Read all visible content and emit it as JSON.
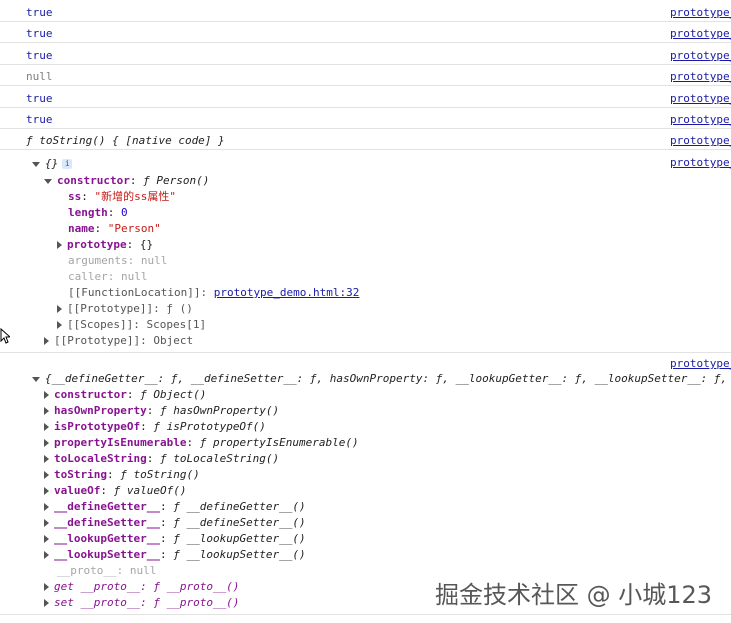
{
  "rows": [
    {
      "value": "true",
      "type": "bool",
      "link": "prototype_"
    },
    {
      "value": "true",
      "type": "bool",
      "link": "prototype_"
    },
    {
      "value": "true",
      "type": "bool",
      "link": "prototype_"
    },
    {
      "value": "null",
      "type": "null",
      "link": "prototype_"
    },
    {
      "value": "true",
      "type": "bool",
      "link": "prototype_"
    },
    {
      "value": "true",
      "type": "bool",
      "link": "prototype_"
    },
    {
      "value": "ƒ toString() { [native code] }",
      "type": "fn",
      "link": "prototype_"
    }
  ],
  "obj1": {
    "link": "prototype_",
    "summary": "{}",
    "constructor_key": "constructor",
    "constructor_val": "ƒ Person()",
    "ss_key": "ss",
    "ss_val": "\"新增的ss属性\"",
    "length_key": "length",
    "length_val": "0",
    "name_key": "name",
    "name_val": "\"Person\"",
    "prototype_key": "prototype",
    "prototype_val": "{}",
    "arguments": "arguments: null",
    "caller": "caller: null",
    "fnloc_key": "[[FunctionLocation]]: ",
    "fnloc_link": "prototype_demo.html:32",
    "proto_inner": "[[Prototype]]: ƒ ()",
    "scopes": "[[Scopes]]: Scopes[1]",
    "proto_outer": "[[Prototype]]: Object"
  },
  "obj2": {
    "link": "prototype_",
    "summary": "{__defineGetter__: ƒ, __defineSetter__: ƒ, hasOwnProperty: ƒ, __lookupGetter__: ƒ, __lookupSetter__: ƒ, …}",
    "props": [
      {
        "key": "constructor",
        "val": "ƒ Object()"
      },
      {
        "key": "hasOwnProperty",
        "val": "ƒ hasOwnProperty()"
      },
      {
        "key": "isPrototypeOf",
        "val": "ƒ isPrototypeOf()"
      },
      {
        "key": "propertyIsEnumerable",
        "val": "ƒ propertyIsEnumerable()"
      },
      {
        "key": "toLocaleString",
        "val": "ƒ toLocaleString()"
      },
      {
        "key": "toString",
        "val": "ƒ toString()"
      },
      {
        "key": "valueOf",
        "val": "ƒ valueOf()"
      },
      {
        "key": "__defineGetter__",
        "val": "ƒ __defineGetter__()"
      },
      {
        "key": "__defineSetter__",
        "val": "ƒ __defineSetter__()"
      },
      {
        "key": "__lookupGetter__",
        "val": "ƒ __lookupGetter__()"
      },
      {
        "key": "__lookupSetter__",
        "val": "ƒ __lookupSetter__()"
      }
    ],
    "proto_null": "__proto__: null",
    "get_proto": "get __proto__: ƒ __proto__()",
    "set_proto": "set __proto__: ƒ __proto__()"
  },
  "watermark": "掘金技术社区 @ 小城123",
  "colors": {
    "link": "#1a1aa6",
    "key": "#881391",
    "string": "#c41a16",
    "number": "#1c00cf",
    "null": "#808080"
  }
}
